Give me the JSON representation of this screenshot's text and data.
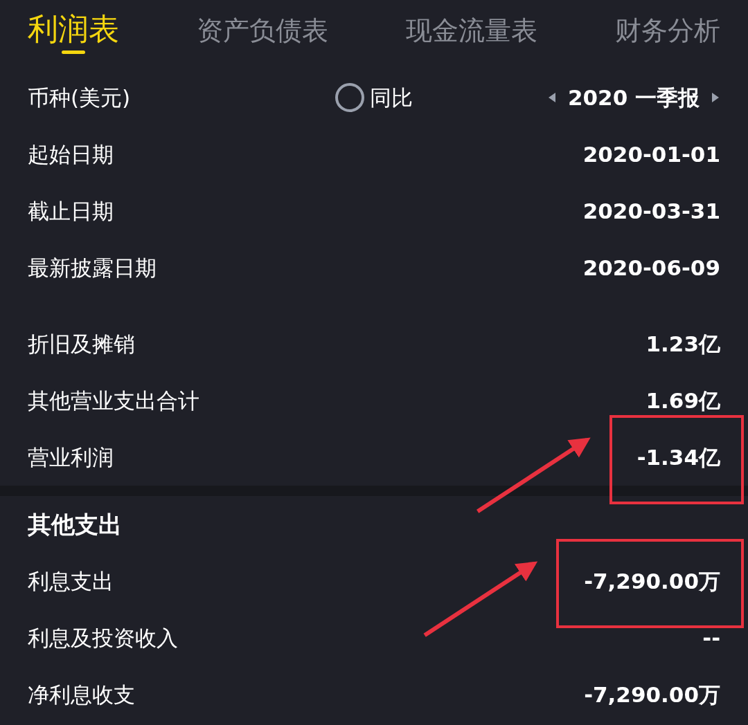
{
  "tabs": [
    {
      "label": "利润表",
      "selected": true
    },
    {
      "label": "资产负债表",
      "selected": false
    },
    {
      "label": "现金流量表",
      "selected": false
    },
    {
      "label": "财务分析",
      "selected": false
    }
  ],
  "header": {
    "currency": "币种(美元)",
    "yoy": {
      "label": "同比",
      "checked": false
    },
    "period": "2020 一季报"
  },
  "rows": [
    {
      "kind": "row",
      "label": "起始日期",
      "value": "2020-01-01",
      "highlighted": false
    },
    {
      "kind": "row",
      "label": "截止日期",
      "value": "2020-03-31",
      "highlighted": false
    },
    {
      "kind": "row",
      "label": "最新披露日期",
      "value": "2020-06-09",
      "highlighted": false
    },
    {
      "kind": "clipped"
    },
    {
      "kind": "row",
      "label": "折旧及摊销",
      "value": "1.23亿",
      "highlighted": false
    },
    {
      "kind": "row",
      "label": "其他营业支出合计",
      "value": "1.69亿",
      "highlighted": false
    },
    {
      "kind": "row",
      "label": "营业利润",
      "value": "-1.34亿",
      "highlighted": true
    },
    {
      "kind": "divider"
    },
    {
      "kind": "section",
      "label": "其他支出"
    },
    {
      "kind": "row",
      "label": "利息支出",
      "value": "-7,290.00万",
      "highlighted": true
    },
    {
      "kind": "row",
      "label": "利息及投资收入",
      "value": "--",
      "highlighted": false
    },
    {
      "kind": "row",
      "label": "净利息收支",
      "value": "-7,290.00万",
      "highlighted": false
    }
  ]
}
